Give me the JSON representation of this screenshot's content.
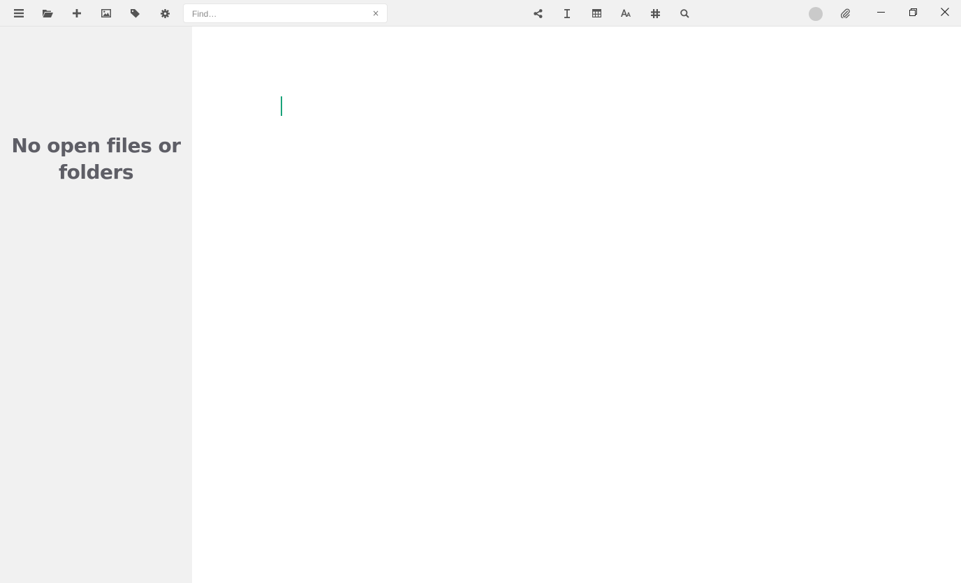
{
  "toolbar": {
    "left_icons": [
      "menu-icon",
      "folder-open-icon",
      "plus-icon",
      "image-icon",
      "tag-icon",
      "gear-icon"
    ],
    "search": {
      "placeholder": "Find…",
      "value": "",
      "clear_label": "×"
    },
    "center_icons": [
      "share-icon",
      "text-cursor-icon",
      "table-icon",
      "font-icon",
      "hashtag-icon",
      "search-icon"
    ],
    "right_icons": [
      "status-dot",
      "attachment-icon"
    ],
    "window_controls": [
      "minimize-icon",
      "restore-icon",
      "close-icon"
    ]
  },
  "sidebar": {
    "empty_message": "No open files or folders"
  },
  "colors": {
    "toolbar_bg": "#f1f1f1",
    "sidebar_bg": "#f1f1f1",
    "editor_bg": "#ffffff",
    "caret": "#1aa37a",
    "icon": "#555555",
    "empty_text": "#5e5e66"
  }
}
